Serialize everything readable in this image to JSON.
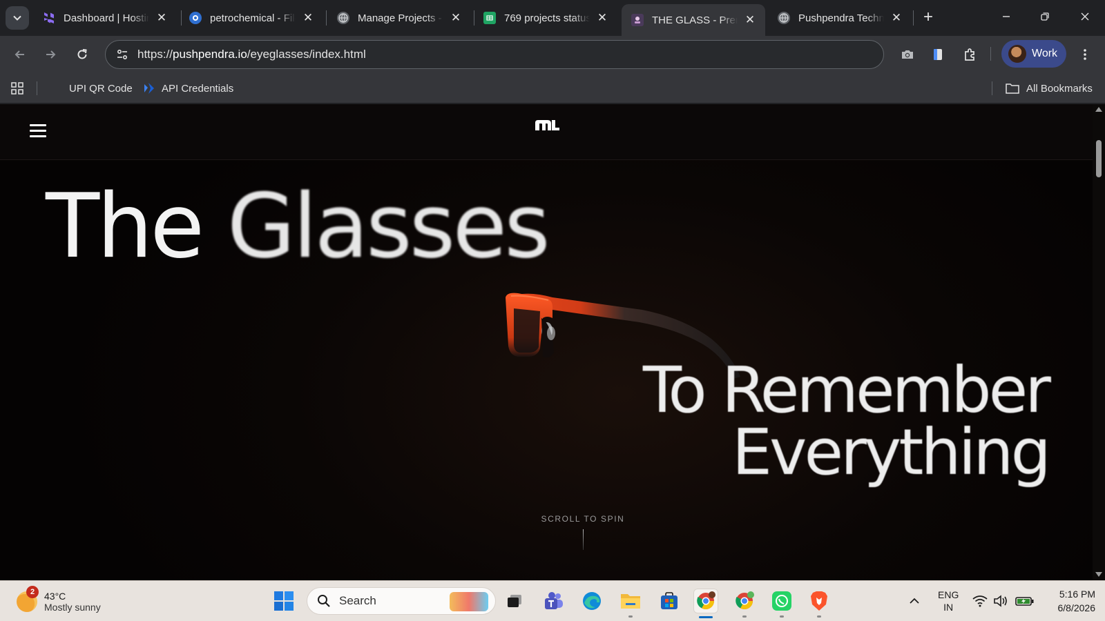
{
  "tabs": [
    {
      "title": "Dashboard | Hosting",
      "favicon": "hostinger-icon",
      "color": "#673de6"
    },
    {
      "title": "petrochemical - Files",
      "favicon": "petro-icon",
      "color": "#2f6fd0"
    },
    {
      "title": "Manage Projects - ",
      "favicon": "globe-icon",
      "color": "#5f6368"
    },
    {
      "title": "769 projects status",
      "favicon": "sheets-icon",
      "color": "#1fa463"
    },
    {
      "title": "THE GLASS - Premium",
      "favicon": "glass-icon",
      "color": "#c9a6d6"
    },
    {
      "title": "Pushpendra Technologies",
      "favicon": "globe-icon",
      "color": "#5f6368"
    }
  ],
  "omnibox": {
    "scheme": "https://",
    "host": "pushpendra.io",
    "path": "/eyeglasses/index.html"
  },
  "profile": {
    "label": "Work"
  },
  "bookmarks": {
    "items": [
      "UPI QR Code",
      "API Credentials"
    ],
    "all_label": "All Bookmarks"
  },
  "hero": {
    "title_part1": "The",
    "title_part2": "Glasses",
    "tagline_line1": "To Remember",
    "tagline_line2": "Everything",
    "scroll_hint": "SCROLL TO SPIN"
  },
  "taskbar": {
    "weather_temp": "43°C",
    "weather_desc": "Mostly sunny",
    "weather_badge": "2",
    "search_placeholder": "Search",
    "lang_line1": "ENG",
    "lang_line2": "IN",
    "time": "5:16 PM",
    "date": "6/8/2026"
  },
  "colors": {
    "accent": "#3b4a8b",
    "glasses_frame": "#e2451b",
    "page_bg": "#060403"
  }
}
